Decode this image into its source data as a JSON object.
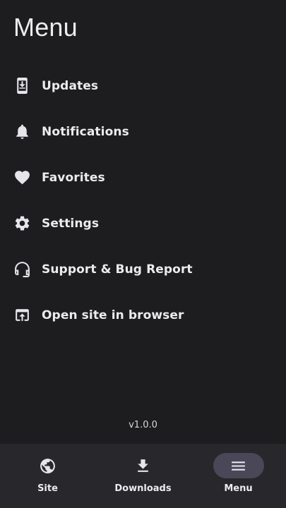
{
  "header": {
    "title": "Menu"
  },
  "menu": {
    "items": [
      {
        "label": "Updates",
        "icon": "phone-download-icon"
      },
      {
        "label": "Notifications",
        "icon": "bell-icon"
      },
      {
        "label": "Favorites",
        "icon": "heart-icon"
      },
      {
        "label": "Settings",
        "icon": "gear-icon"
      },
      {
        "label": "Support & Bug Report",
        "icon": "headset-icon"
      },
      {
        "label": "Open site in browser",
        "icon": "open-in-browser-icon"
      }
    ]
  },
  "footer": {
    "version": "v1.0.0"
  },
  "bottom_nav": {
    "items": [
      {
        "label": "Site",
        "icon": "globe-icon",
        "active": false
      },
      {
        "label": "Downloads",
        "icon": "download-icon",
        "active": false
      },
      {
        "label": "Menu",
        "icon": "hamburger-menu-icon",
        "active": true
      }
    ]
  },
  "colors": {
    "background": "#1d1d20",
    "nav_background": "#28272c",
    "active_pill": "#4a4759",
    "text": "#ececef"
  }
}
